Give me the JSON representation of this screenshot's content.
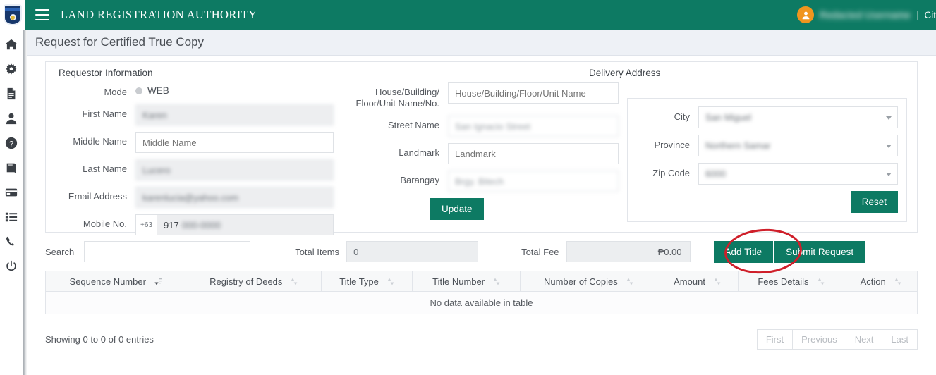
{
  "topbar": {
    "logo_alt": "LRA shield logo",
    "brand": "LAND REGISTRATION AUTHORITY",
    "user_name": "Redacted Username",
    "separator": "|",
    "cit_label": "Cit",
    "accent_color": "#0d7a63"
  },
  "sidebar": {
    "items": [
      {
        "name": "home",
        "label": "Home"
      },
      {
        "name": "gear",
        "label": "Settings"
      },
      {
        "name": "document",
        "label": "Documents"
      },
      {
        "name": "user",
        "label": "Profile"
      },
      {
        "name": "question",
        "label": "Help"
      },
      {
        "name": "book",
        "label": "Records"
      },
      {
        "name": "card",
        "label": "Payments"
      },
      {
        "name": "list",
        "label": "Transactions"
      },
      {
        "name": "phone",
        "label": "Contact"
      },
      {
        "name": "power",
        "label": "Logout"
      }
    ]
  },
  "page": {
    "title": "Request for Certified True Copy"
  },
  "requestor": {
    "section_title": "Requestor Information",
    "mode_label": "Mode",
    "mode_value": "WEB",
    "fields": [
      {
        "label": "First Name",
        "value": "Karen",
        "placeholder": "First Name",
        "filled": true,
        "blurred": true
      },
      {
        "label": "Middle Name",
        "value": "",
        "placeholder": "Middle Name",
        "filled": false,
        "blurred": false
      },
      {
        "label": "Last Name",
        "value": "Lucero",
        "placeholder": "Last Name",
        "filled": true,
        "blurred": true
      },
      {
        "label": "Email Address",
        "value": "karenlucia@yahoo.com",
        "placeholder": "Email Address",
        "filled": true,
        "blurred": true
      }
    ],
    "mobile_label": "Mobile No.",
    "mobile_prefix": "+63",
    "mobile_visible": "917-",
    "mobile_hidden": "000-0000"
  },
  "address": {
    "fields": [
      {
        "label": "House/Building/ Floor/Unit Name/No.",
        "value": "",
        "placeholder": "House/Building/Floor/Unit Name",
        "filled": false,
        "blurred": false
      },
      {
        "label": "Street Name",
        "value": "San Ignacio Street",
        "placeholder": "Street Name",
        "filled": true,
        "blurred": true
      },
      {
        "label": "Landmark",
        "value": "",
        "placeholder": "Landmark",
        "filled": false,
        "blurred": false
      },
      {
        "label": "Barangay",
        "value": "Brgy. Bitech",
        "placeholder": "Barangay",
        "filled": true,
        "blurred": true
      }
    ],
    "update_label": "Update"
  },
  "delivery": {
    "section_title": "Delivery Address",
    "fields": [
      {
        "label": "City",
        "value": "San Miguel"
      },
      {
        "label": "Province",
        "value": "Northern Samar"
      },
      {
        "label": "Zip Code",
        "value": "6000"
      }
    ],
    "reset_label": "Reset"
  },
  "toolbar": {
    "search_label": "Search",
    "search_value": "",
    "search_placeholder": "",
    "total_items_label": "Total Items",
    "total_items_value": "0",
    "total_fee_label": "Total Fee",
    "total_fee_value": "₱0.00",
    "add_title_label": "Add Title",
    "submit_label": "Submit Request",
    "annotation_color": "#cf1f2a"
  },
  "table": {
    "columns": [
      {
        "label": "Sequence Number",
        "sort": "desc"
      },
      {
        "label": "Registry of Deeds",
        "sort": "none"
      },
      {
        "label": "Title Type",
        "sort": "none"
      },
      {
        "label": "Title Number",
        "sort": "none"
      },
      {
        "label": "Number of Copies",
        "sort": "none"
      },
      {
        "label": "Amount",
        "sort": "none"
      },
      {
        "label": "Fees Details",
        "sort": "none"
      },
      {
        "label": "Action",
        "sort": "none"
      }
    ],
    "empty_message": "No data available in table",
    "showing": "Showing 0 to 0 of 0 entries",
    "pager": [
      "First",
      "Previous",
      "Next",
      "Last"
    ]
  }
}
